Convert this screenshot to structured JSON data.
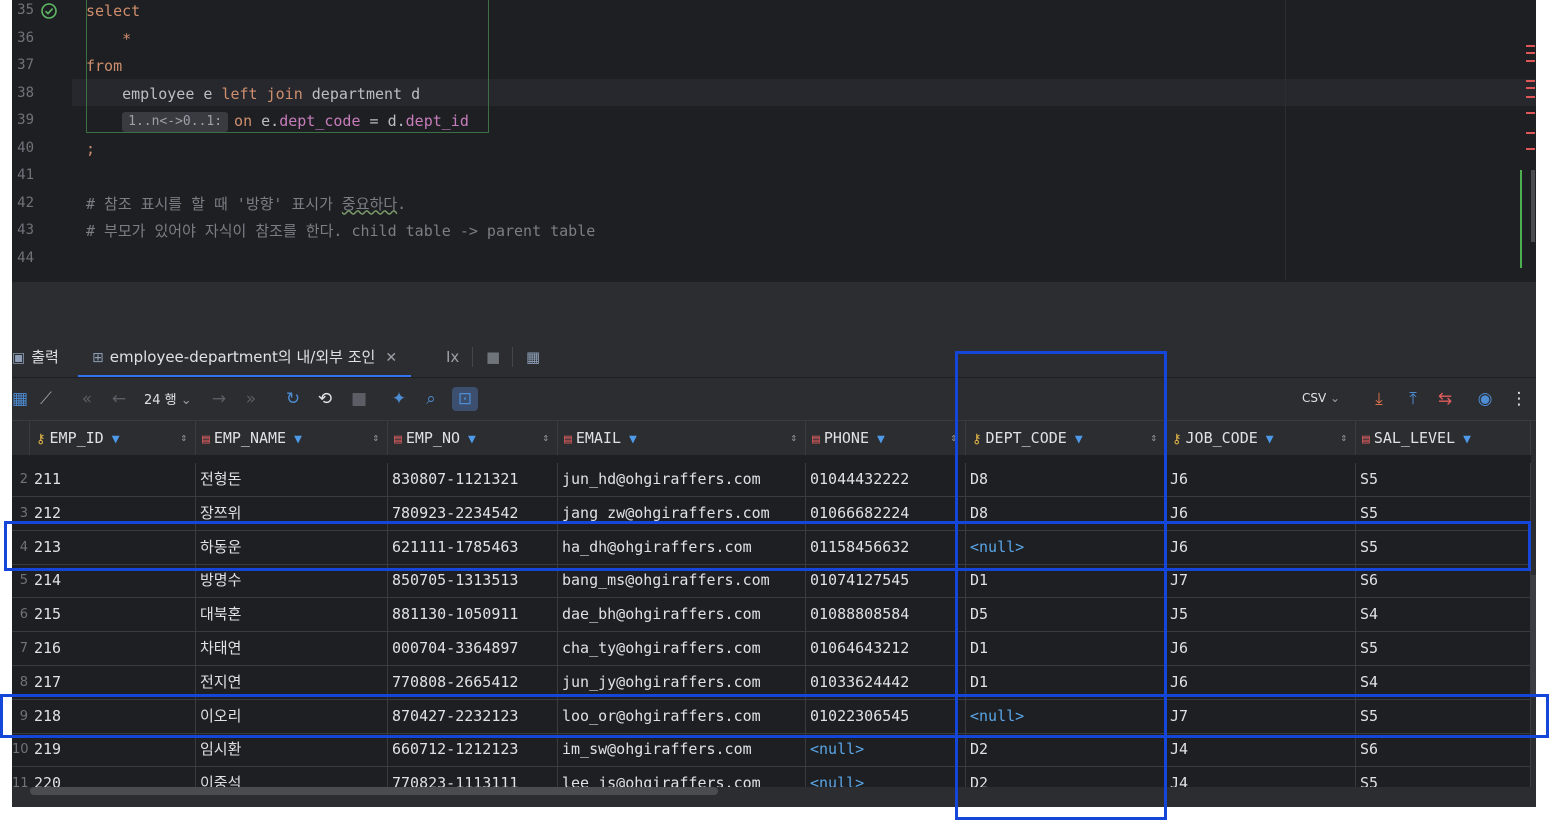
{
  "editor": {
    "lines": [
      {
        "no": "35",
        "tokens": [
          {
            "t": "select",
            "c": "kw"
          }
        ]
      },
      {
        "no": "36",
        "tokens": [
          {
            "t": "    *",
            "c": "kw"
          }
        ]
      },
      {
        "no": "37",
        "tokens": [
          {
            "t": "from",
            "c": "kw"
          }
        ]
      },
      {
        "no": "38",
        "tokens": [
          {
            "t": "    employee e ",
            "c": ""
          },
          {
            "t": "left join",
            "c": "kw"
          },
          {
            "t": " department d",
            "c": ""
          }
        ]
      },
      {
        "no": "39",
        "tokens": [
          {
            "t": "    ",
            "c": ""
          },
          {
            "t": "1..n<->0..1:",
            "c": "hint"
          },
          {
            "t": "on",
            "c": "kw"
          },
          {
            "t": " e.",
            "c": ""
          },
          {
            "t": "dept_code",
            "c": "fld"
          },
          {
            "t": " = d.",
            "c": ""
          },
          {
            "t": "dept_id",
            "c": "fld"
          }
        ]
      },
      {
        "no": "40",
        "tokens": [
          {
            "t": ";",
            "c": "kw"
          }
        ]
      },
      {
        "no": "41",
        "tokens": []
      },
      {
        "no": "42",
        "tokens": [
          {
            "t": "# 참조 표시를 할 때 '방향' 표시가 ",
            "c": "cmt"
          },
          {
            "t": "중요하다",
            "c": "cmt squig"
          },
          {
            "t": ".",
            "c": "cmt"
          }
        ]
      },
      {
        "no": "43",
        "tokens": [
          {
            "t": "# 부모가 있어야 자식이 참조를 한다. child table -> parent table",
            "c": "cmt"
          }
        ]
      },
      {
        "no": "44",
        "tokens": []
      }
    ],
    "gutter_icon": "check-circle-icon"
  },
  "tabs": {
    "output_label": "출력",
    "result_label": "employee-department의 내/외부 조인",
    "fx_label": "Ix"
  },
  "toolbar": {
    "rows_label": "24 행",
    "export_format": "CSV"
  },
  "grid": {
    "columns": [
      {
        "name": "EMP_ID",
        "icon": "key-icon"
      },
      {
        "name": "EMP_NAME",
        "icon": "column-icon"
      },
      {
        "name": "EMP_NO",
        "icon": "column-icon"
      },
      {
        "name": "EMAIL",
        "icon": "column-icon"
      },
      {
        "name": "PHONE",
        "icon": "column-icon"
      },
      {
        "name": "DEPT_CODE",
        "icon": "key-icon"
      },
      {
        "name": "JOB_CODE",
        "icon": "key-icon"
      },
      {
        "name": "SAL_LEVEL",
        "icon": "column-icon"
      }
    ],
    "rows": [
      {
        "num": "2",
        "cells": [
          "211",
          "전형돈",
          "830807-1121321",
          "jun_hd@ohgiraffers.com",
          "01044432222",
          "D8",
          "J6",
          "S5"
        ]
      },
      {
        "num": "3",
        "cells": [
          "212",
          "장쯔위",
          "780923-2234542",
          "jang_zw@ohgiraffers.com",
          "01066682224",
          "D8",
          "J6",
          "S5"
        ]
      },
      {
        "num": "4",
        "cells": [
          "213",
          "하동운",
          "621111-1785463",
          "ha_dh@ohgiraffers.com",
          "01158456632",
          "<null>",
          "J6",
          "S5"
        ]
      },
      {
        "num": "5",
        "cells": [
          "214",
          "방명수",
          "850705-1313513",
          "bang_ms@ohgiraffers.com",
          "01074127545",
          "D1",
          "J7",
          "S6"
        ]
      },
      {
        "num": "6",
        "cells": [
          "215",
          "대북혼",
          "881130-1050911",
          "dae_bh@ohgiraffers.com",
          "01088808584",
          "D5",
          "J5",
          "S4"
        ]
      },
      {
        "num": "7",
        "cells": [
          "216",
          "차태연",
          "000704-3364897",
          "cha_ty@ohgiraffers.com",
          "01064643212",
          "D1",
          "J6",
          "S5"
        ]
      },
      {
        "num": "8",
        "cells": [
          "217",
          "전지연",
          "770808-2665412",
          "jun_jy@ohgiraffers.com",
          "01033624442",
          "D1",
          "J6",
          "S4"
        ]
      },
      {
        "num": "9",
        "cells": [
          "218",
          "이오리",
          "870427-2232123",
          "loo_or@ohgiraffers.com",
          "01022306545",
          "<null>",
          "J7",
          "S5"
        ]
      },
      {
        "num": "10",
        "cells": [
          "219",
          "임시환",
          "660712-1212123",
          "im_sw@ohgiraffers.com",
          "<null>",
          "D2",
          "J4",
          "S6"
        ]
      },
      {
        "num": "11",
        "cells": [
          "220",
          "이중석",
          "770823-1113111",
          "lee_js@ohgiraffers.com",
          "<null>",
          "D2",
          "J4",
          "S5"
        ]
      }
    ]
  },
  "colors": {
    "accent": "#3574f0",
    "annotation": "#1446d9",
    "null_value": "#5aa6e8",
    "keyword": "#cf8e6d"
  }
}
